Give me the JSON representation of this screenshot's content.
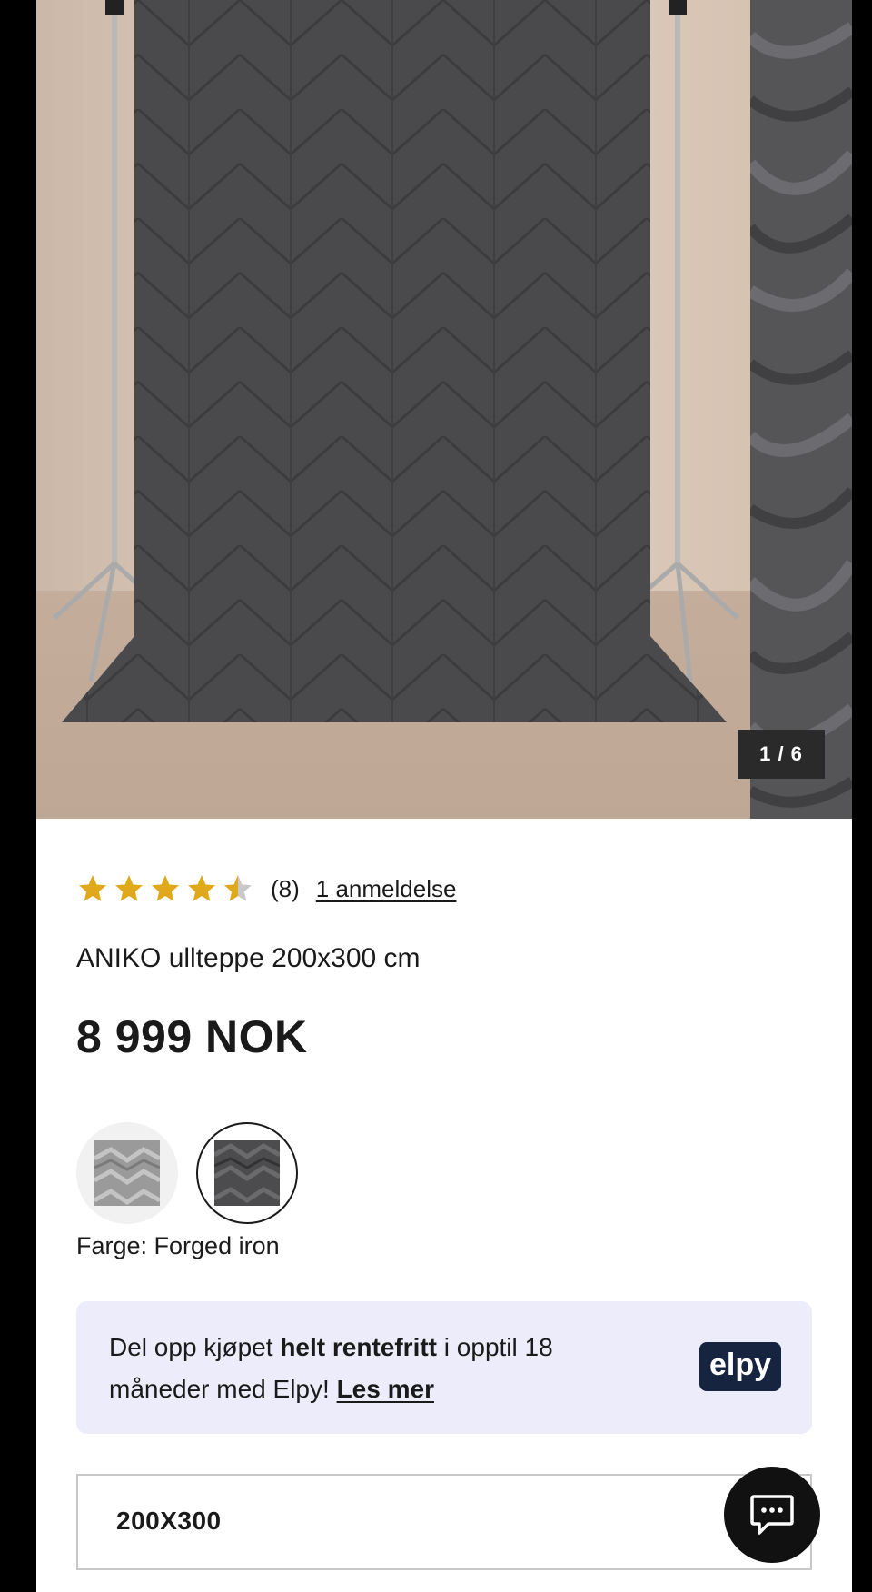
{
  "gallery": {
    "counter": "1 / 6",
    "image_alt": "ANIKO ullteppe, Forged iron"
  },
  "product": {
    "rating": 4.5,
    "rating_count": "(8)",
    "reviews_link": "1 anmeldelse",
    "title": "ANIKO ullteppe 200x300 cm",
    "price": "8 999 NOK",
    "color_label": "Farge: Forged iron",
    "swatches": [
      "light-grey",
      "forged-iron"
    ],
    "selected_swatch": "forged-iron"
  },
  "elpy": {
    "text_before": "Del opp kjøpet ",
    "text_bold": "helt rentefritt",
    "text_after": " i opptil 18 måneder med Elpy! ",
    "link": "Les mer",
    "logo": "elpy"
  },
  "size_select": {
    "value": "200X300"
  },
  "colors": {
    "star": "#e0a91b",
    "elpy_bg": "#ececfa",
    "elpy_logo_bg": "#16243f",
    "rug": "#4a4a4c",
    "wall": "#d8c6b7"
  },
  "icons": {
    "chat": "chat-bubble-icon",
    "star": "star-icon"
  }
}
